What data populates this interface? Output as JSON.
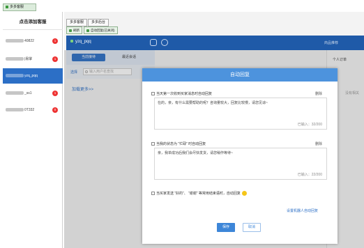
{
  "app": {
    "tab_label": "多多客服"
  },
  "sidebar": {
    "title": "点击添加客服",
    "contacts": [
      {
        "label": "40822",
        "badge": "1"
      },
      {
        "label": "|易掌",
        "badge": "1"
      },
      {
        "label": "yzq_pqq",
        "badge": ""
      },
      {
        "label": "_ss1",
        "badge": "1"
      },
      {
        "label": "0T332",
        "badge": "0"
      }
    ]
  },
  "tabs": [
    "多多客服",
    "多多后台"
  ],
  "toolbar": {
    "refresh": "刷新",
    "auto_reply": "自动回复(已关闭)"
  },
  "chat": {
    "name": "yzq_pqq",
    "right_link": "商品推荐",
    "right_panel_tab": "个人订单",
    "right_panel_note": "没有相关"
  },
  "subtabs": {
    "current": "当前接待",
    "recent": "最近会话"
  },
  "search": {
    "label": "选择",
    "placeholder": "输入用户名查找"
  },
  "load_more": "加载更多>>",
  "modal": {
    "title": "自动回复",
    "rule1": {
      "label": "当天第一次收到买家消息时自动回复",
      "delete": "删除",
      "text": "在的，亲，有什么需要帮助的呢？咨询量较大，回复比较慢，请您见谅~",
      "count": "已输入：32/200"
    },
    "rule2": {
      "label": "当我的状态为 “忙碌” 时自动回复",
      "delete": "删除",
      "text": "亲，我单成功后我们会尽快发货，请您稍作等待~",
      "count": "已输入：22/200"
    },
    "rule3": {
      "label": "当买家发送 “好的”、 “谢谢” 等常用结束语时，自动回复"
    },
    "robot_link": "设置机器人自动回复",
    "save": "保存",
    "cancel": "取消"
  }
}
